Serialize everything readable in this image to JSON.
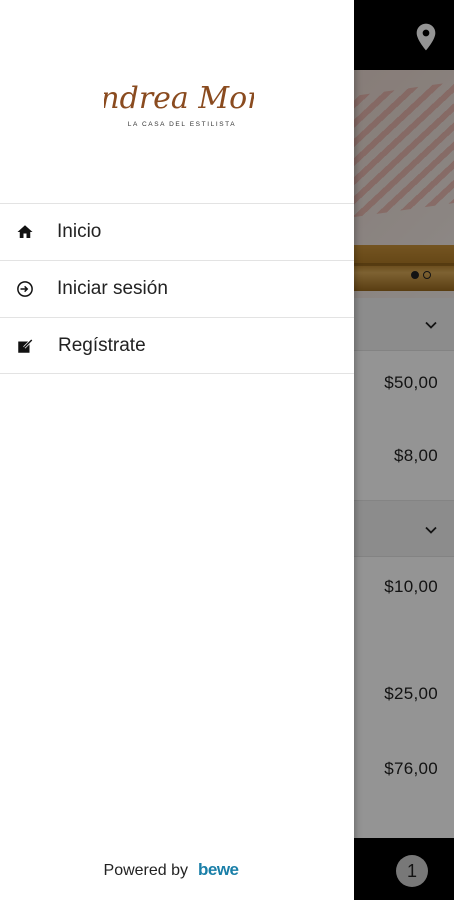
{
  "drawer": {
    "logo_name": "Andrea Mora",
    "logo_tagline": "LA CASA DEL ESTILISTA",
    "menu": [
      {
        "label": "Inicio",
        "icon": "home-icon"
      },
      {
        "label": "Iniciar sesión",
        "icon": "login-icon"
      },
      {
        "label": "Regístrate",
        "icon": "register-icon"
      }
    ],
    "powered_by": "Powered by",
    "brand": "bewe"
  },
  "background": {
    "prices": [
      "$50,00",
      "$8,00",
      "$10,00",
      "$25,00",
      "$76,00"
    ],
    "cart_count": "1"
  },
  "colors": {
    "logo_brown": "#8a4b1f",
    "brand_blue": "#1a7fa8",
    "brand_dark": "#0b3a52",
    "overlay": "#000000"
  }
}
